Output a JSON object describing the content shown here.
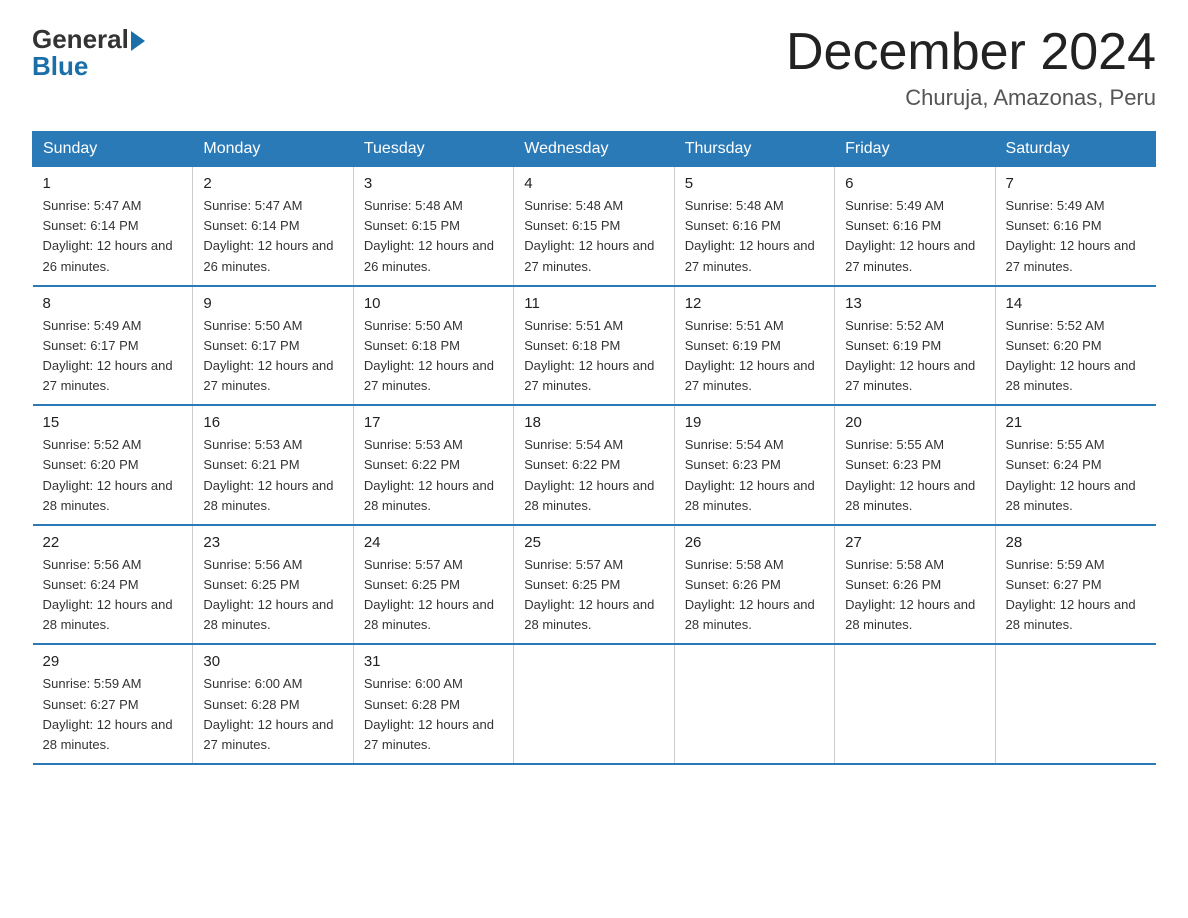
{
  "header": {
    "logo_general": "General",
    "logo_blue": "Blue",
    "month_title": "December 2024",
    "location": "Churuja, Amazonas, Peru"
  },
  "days_of_week": [
    "Sunday",
    "Monday",
    "Tuesday",
    "Wednesday",
    "Thursday",
    "Friday",
    "Saturday"
  ],
  "weeks": [
    [
      {
        "day": "1",
        "info": "Sunrise: 5:47 AM\nSunset: 6:14 PM\nDaylight: 12 hours\nand 26 minutes."
      },
      {
        "day": "2",
        "info": "Sunrise: 5:47 AM\nSunset: 6:14 PM\nDaylight: 12 hours\nand 26 minutes."
      },
      {
        "day": "3",
        "info": "Sunrise: 5:48 AM\nSunset: 6:15 PM\nDaylight: 12 hours\nand 26 minutes."
      },
      {
        "day": "4",
        "info": "Sunrise: 5:48 AM\nSunset: 6:15 PM\nDaylight: 12 hours\nand 27 minutes."
      },
      {
        "day": "5",
        "info": "Sunrise: 5:48 AM\nSunset: 6:16 PM\nDaylight: 12 hours\nand 27 minutes."
      },
      {
        "day": "6",
        "info": "Sunrise: 5:49 AM\nSunset: 6:16 PM\nDaylight: 12 hours\nand 27 minutes."
      },
      {
        "day": "7",
        "info": "Sunrise: 5:49 AM\nSunset: 6:16 PM\nDaylight: 12 hours\nand 27 minutes."
      }
    ],
    [
      {
        "day": "8",
        "info": "Sunrise: 5:49 AM\nSunset: 6:17 PM\nDaylight: 12 hours\nand 27 minutes."
      },
      {
        "day": "9",
        "info": "Sunrise: 5:50 AM\nSunset: 6:17 PM\nDaylight: 12 hours\nand 27 minutes."
      },
      {
        "day": "10",
        "info": "Sunrise: 5:50 AM\nSunset: 6:18 PM\nDaylight: 12 hours\nand 27 minutes."
      },
      {
        "day": "11",
        "info": "Sunrise: 5:51 AM\nSunset: 6:18 PM\nDaylight: 12 hours\nand 27 minutes."
      },
      {
        "day": "12",
        "info": "Sunrise: 5:51 AM\nSunset: 6:19 PM\nDaylight: 12 hours\nand 27 minutes."
      },
      {
        "day": "13",
        "info": "Sunrise: 5:52 AM\nSunset: 6:19 PM\nDaylight: 12 hours\nand 27 minutes."
      },
      {
        "day": "14",
        "info": "Sunrise: 5:52 AM\nSunset: 6:20 PM\nDaylight: 12 hours\nand 28 minutes."
      }
    ],
    [
      {
        "day": "15",
        "info": "Sunrise: 5:52 AM\nSunset: 6:20 PM\nDaylight: 12 hours\nand 28 minutes."
      },
      {
        "day": "16",
        "info": "Sunrise: 5:53 AM\nSunset: 6:21 PM\nDaylight: 12 hours\nand 28 minutes."
      },
      {
        "day": "17",
        "info": "Sunrise: 5:53 AM\nSunset: 6:22 PM\nDaylight: 12 hours\nand 28 minutes."
      },
      {
        "day": "18",
        "info": "Sunrise: 5:54 AM\nSunset: 6:22 PM\nDaylight: 12 hours\nand 28 minutes."
      },
      {
        "day": "19",
        "info": "Sunrise: 5:54 AM\nSunset: 6:23 PM\nDaylight: 12 hours\nand 28 minutes."
      },
      {
        "day": "20",
        "info": "Sunrise: 5:55 AM\nSunset: 6:23 PM\nDaylight: 12 hours\nand 28 minutes."
      },
      {
        "day": "21",
        "info": "Sunrise: 5:55 AM\nSunset: 6:24 PM\nDaylight: 12 hours\nand 28 minutes."
      }
    ],
    [
      {
        "day": "22",
        "info": "Sunrise: 5:56 AM\nSunset: 6:24 PM\nDaylight: 12 hours\nand 28 minutes."
      },
      {
        "day": "23",
        "info": "Sunrise: 5:56 AM\nSunset: 6:25 PM\nDaylight: 12 hours\nand 28 minutes."
      },
      {
        "day": "24",
        "info": "Sunrise: 5:57 AM\nSunset: 6:25 PM\nDaylight: 12 hours\nand 28 minutes."
      },
      {
        "day": "25",
        "info": "Sunrise: 5:57 AM\nSunset: 6:25 PM\nDaylight: 12 hours\nand 28 minutes."
      },
      {
        "day": "26",
        "info": "Sunrise: 5:58 AM\nSunset: 6:26 PM\nDaylight: 12 hours\nand 28 minutes."
      },
      {
        "day": "27",
        "info": "Sunrise: 5:58 AM\nSunset: 6:26 PM\nDaylight: 12 hours\nand 28 minutes."
      },
      {
        "day": "28",
        "info": "Sunrise: 5:59 AM\nSunset: 6:27 PM\nDaylight: 12 hours\nand 28 minutes."
      }
    ],
    [
      {
        "day": "29",
        "info": "Sunrise: 5:59 AM\nSunset: 6:27 PM\nDaylight: 12 hours\nand 28 minutes."
      },
      {
        "day": "30",
        "info": "Sunrise: 6:00 AM\nSunset: 6:28 PM\nDaylight: 12 hours\nand 27 minutes."
      },
      {
        "day": "31",
        "info": "Sunrise: 6:00 AM\nSunset: 6:28 PM\nDaylight: 12 hours\nand 27 minutes."
      },
      {
        "day": "",
        "info": ""
      },
      {
        "day": "",
        "info": ""
      },
      {
        "day": "",
        "info": ""
      },
      {
        "day": "",
        "info": ""
      }
    ]
  ]
}
